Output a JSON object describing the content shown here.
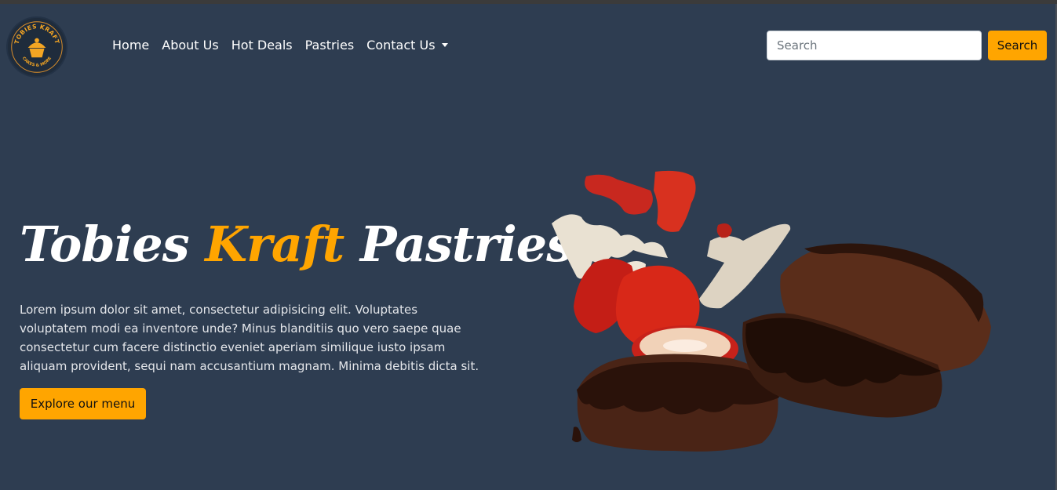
{
  "brand": {
    "logo_text_top": "TOBIES KRAFT",
    "logo_text_bottom": "CAKES & MORE",
    "logo_icon": "cupcake-icon"
  },
  "nav": {
    "items": [
      {
        "label": "Home"
      },
      {
        "label": "About Us"
      },
      {
        "label": "Hot Deals"
      },
      {
        "label": "Pastries"
      },
      {
        "label": "Contact Us",
        "dropdown": true
      }
    ]
  },
  "search": {
    "placeholder": "Search",
    "value": "",
    "button_label": "Search"
  },
  "hero": {
    "title_part1": "Tobies",
    "title_accent": "Kraft",
    "title_part2": "Pastries",
    "description": "Lorem ipsum dolor sit amet, consectetur adipisicing elit. Voluptates voluptatem modi ea inventore unde? Minus blanditiis quo vero saepe quae consectetur cum facere distinctio eveniet aperiam similique iusto ipsam aliquam provident, sequi nam accusantium magnam. Minima debitis dicta sit.",
    "cta_label": "Explore our menu",
    "image": "chocolate-cake-strawberries-image"
  },
  "colors": {
    "background": "#2e3d51",
    "accent": "#ffa500",
    "text": "#ffffff"
  }
}
